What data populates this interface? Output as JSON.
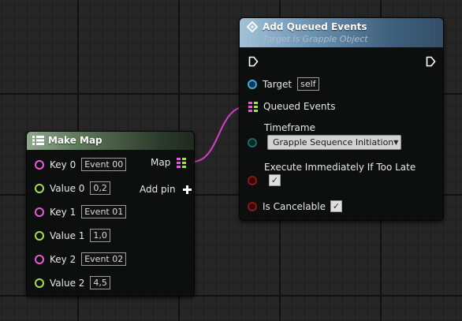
{
  "make_map": {
    "title": "Make Map",
    "output_label": "Map",
    "add_pin_label": "Add pin",
    "add_pin_icon": "plus-icon",
    "header_icon": "map-node-icon",
    "rows": [
      {
        "label": "Key 0",
        "value": "Event 00",
        "kind": "key"
      },
      {
        "label": "Value 0",
        "value": "0,2",
        "kind": "value"
      },
      {
        "label": "Key 1",
        "value": "Event 01",
        "kind": "key"
      },
      {
        "label": "Value 1",
        "value": "1,0",
        "kind": "value"
      },
      {
        "label": "Key 2",
        "value": "Event 02",
        "kind": "key"
      },
      {
        "label": "Value 2",
        "value": "4,5",
        "kind": "value"
      }
    ]
  },
  "add_queued_events": {
    "title": "Add Queued Events",
    "subtitle": "Target is Grapple Object",
    "header_icon": "function-icon",
    "target": {
      "label": "Target",
      "value": "self"
    },
    "queued_events": {
      "label": "Queued Events"
    },
    "timeframe": {
      "label": "Timeframe",
      "selected": "Grapple Sequence Initiation"
    },
    "execute_immediately": {
      "label": "Execute Immediately If Too Late",
      "checked": true
    },
    "is_cancelable": {
      "label": "Is Cancelable",
      "checked": true
    }
  },
  "colors": {
    "key_pin": "#e85ad9",
    "value_pin": "#a2e052",
    "map_pin_key": "#e85ad9",
    "map_pin_value": "#a2e052",
    "target_pin": "#3fa8e4",
    "timeframe_pin": "#1c6b62",
    "bool_pin": "#8c1818",
    "wire": "#d23ec7"
  }
}
